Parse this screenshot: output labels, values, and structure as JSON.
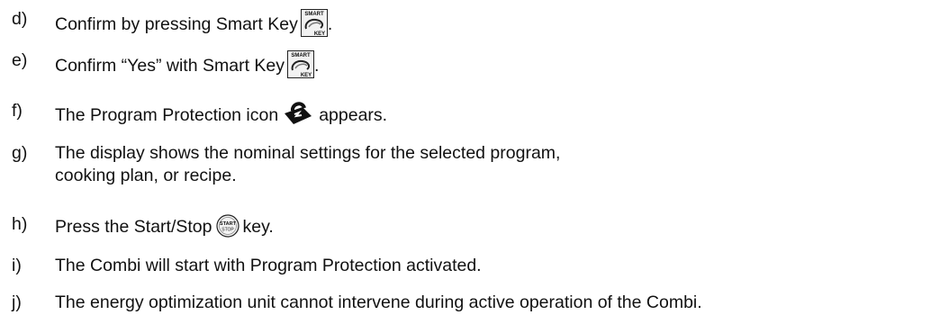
{
  "steps": [
    {
      "letter": "d)",
      "before": "Confirm by pressing Smart Key",
      "after": ".",
      "icon": "smart-key-icon"
    },
    {
      "letter": "e)",
      "before": "Confirm “Yes” with Smart Key",
      "after": ".",
      "icon": "smart-key-icon"
    },
    {
      "letter": "f)",
      "before": "The Program Protection icon",
      "after": "appears.",
      "icon": "program-protection-icon"
    },
    {
      "letter": "g)",
      "line1": "The display shows the nominal settings for the selected program,",
      "line2": "cooking plan, or recipe."
    },
    {
      "letter": "h)",
      "before": "Press the Start/Stop",
      "after": "key.",
      "icon": "start-stop-icon"
    },
    {
      "letter": "i)",
      "text": "The Combi will start with Program Protection activated."
    },
    {
      "letter": "j)",
      "text": "The energy optimization unit cannot intervene during active operation of the Combi."
    }
  ],
  "icons": {
    "smart_key_top": "SMART",
    "smart_key_bottom": "KEY",
    "start_stop_top": "START",
    "start_stop_bottom": "STOP"
  }
}
